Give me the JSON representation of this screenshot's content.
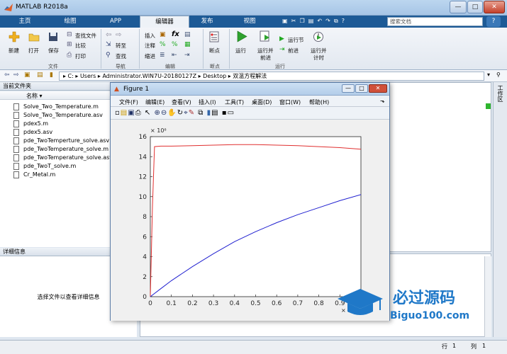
{
  "window": {
    "title": "MATLAB R2018a",
    "minimize": "—",
    "maximize": "□",
    "close": "✕"
  },
  "tabs": [
    "主页",
    "绘图",
    "APP",
    "编辑器",
    "发布",
    "视图"
  ],
  "search": {
    "placeholder": "搜索文档"
  },
  "ribbon": {
    "file": {
      "new": "新建",
      "open": "打开",
      "save": "保存",
      "find_files": "查找文件",
      "compare": "比较",
      "print": "打印",
      "section": "文件"
    },
    "nav": {
      "goto": "转至",
      "find": "查找",
      "section": "导航"
    },
    "edit": {
      "insert": "插入",
      "comment": "注释",
      "indent": "缩进",
      "section": "编辑"
    },
    "breakpoints": {
      "label": "断点",
      "section": "断点"
    },
    "run": {
      "run": "运行",
      "run_advance_1": "运行并",
      "run_advance_2": "前进",
      "run_section": "运行节",
      "advance": "前进",
      "run_time_1": "运行并",
      "run_time_2": "计时",
      "section": "运行"
    }
  },
  "address": {
    "path": "▸  C: ▸ Users ▸ Administrator.WIN7U-20180127Z ▸ Desktop ▸ 双温方程解法"
  },
  "current_folder": {
    "title": "当前文件夹",
    "column": "名称 ▾",
    "files": [
      "Solve_Two_Temperature.m",
      "Solve_Two_Temperature.asv",
      "pdex5.m",
      "pdex5.asv",
      "pde_TwoTemperture_solve.asv",
      "pde_TwoTemperature_solve.m",
      "pde_TwoTemperature_solve.asv",
      "pde_TwoT_solve.m",
      "Cr_Metal.m"
    ]
  },
  "details": {
    "title": "详细信息",
    "hint": "选择文件以查看详细信息"
  },
  "side_label": "工作区",
  "status": {
    "row_label": "行",
    "row": "1",
    "col_label": "列",
    "col": "1"
  },
  "figure": {
    "title": "Figure 1",
    "menus": [
      "文件(F)",
      "编辑(E)",
      "查看(V)",
      "插入(I)",
      "工具(T)",
      "桌面(D)",
      "窗口(W)",
      "帮助(H)"
    ]
  },
  "watermark": {
    "text": "必过源码",
    "url": "Biguo100.com"
  },
  "colors": {
    "series1": "#e03030",
    "series2": "#2020d0",
    "accent": "#1d5a96"
  },
  "chart_data": {
    "type": "line",
    "x_ticks": [
      "0",
      "0.1",
      "0.2",
      "0.3",
      "0.4",
      "0.5",
      "0.6",
      "0.7",
      "0.8",
      "0.9"
    ],
    "y_ticks": [
      "0",
      "2",
      "4",
      "6",
      "8",
      "10",
      "12",
      "14",
      "16"
    ],
    "y_multiplier": "× 10⁸",
    "x_multiplier": "× 10",
    "xlim": [
      0,
      1
    ],
    "ylim": [
      0,
      16
    ],
    "grid": false,
    "series": [
      {
        "color": "red",
        "x": [
          0,
          0.01,
          0.02,
          0.05,
          0.1,
          0.2,
          0.3,
          0.4,
          0.5,
          0.6,
          0.7,
          0.8,
          0.9,
          1.0
        ],
        "values": [
          0,
          9,
          15.0,
          15.05,
          15.05,
          15.1,
          15.15,
          15.2,
          15.2,
          15.15,
          15.1,
          15.0,
          14.9,
          14.75
        ]
      },
      {
        "color": "blue",
        "x": [
          0,
          0.05,
          0.1,
          0.2,
          0.3,
          0.4,
          0.5,
          0.6,
          0.7,
          0.8,
          0.9,
          1.0
        ],
        "values": [
          0,
          0.8,
          1.6,
          3.0,
          4.3,
          5.5,
          6.5,
          7.4,
          8.2,
          8.9,
          9.6,
          10.2
        ]
      }
    ]
  }
}
